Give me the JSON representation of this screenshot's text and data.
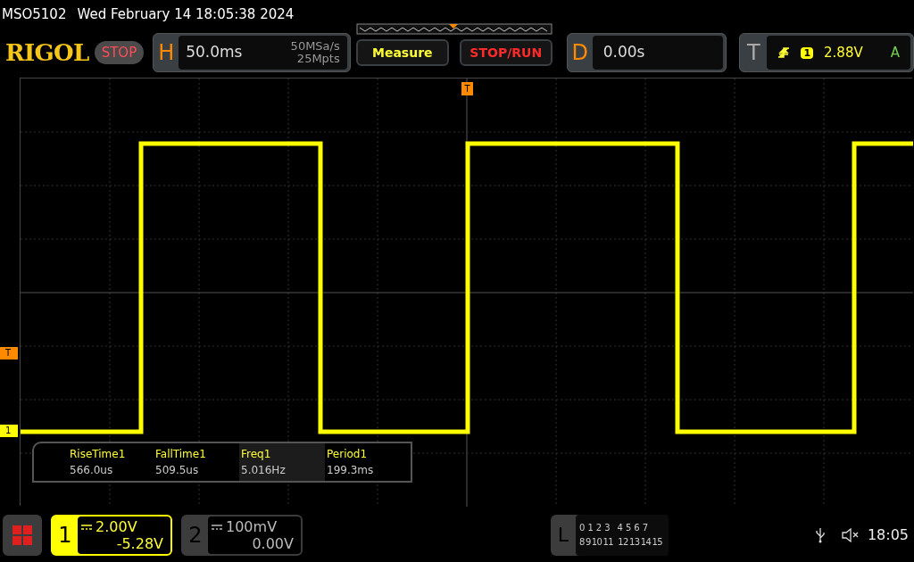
{
  "status_line": {
    "model": "MSO5102",
    "datetime": "Wed February 14 18:05:38 2024"
  },
  "header": {
    "logo": "RIGOL",
    "run_state": "STOP",
    "horizontal": {
      "label": "H",
      "timebase": "50.0ms",
      "sample_rate": "50MSa/s",
      "memory_depth": "25Mpts"
    },
    "buttons": [
      {
        "label": "Measure",
        "kind": "measure"
      },
      {
        "label": "STOP/RUN",
        "kind": "stoprun"
      }
    ],
    "delay": {
      "label": "D",
      "value": "0.00s"
    },
    "trigger": {
      "label": "T",
      "source": "1",
      "level": "2.88V",
      "mode": "A"
    }
  },
  "screen": {
    "top_marker": "T",
    "side_markers": [
      {
        "label": "T",
        "kind": "trigger"
      },
      {
        "label": "1",
        "kind": "channel"
      }
    ],
    "measurements": [
      {
        "name": "RiseTime1",
        "value": "566.0us",
        "selected": false
      },
      {
        "name": "FallTime1",
        "value": "509.5us",
        "selected": false
      },
      {
        "name": "Freq1",
        "value": "5.016Hz",
        "selected": true
      },
      {
        "name": "Period1",
        "value": "199.3ms",
        "selected": false
      }
    ]
  },
  "footer": {
    "channels": [
      {
        "number": "1",
        "scale": "2.00V",
        "offset": "-5.28V",
        "on": true
      },
      {
        "number": "2",
        "scale": "100mV",
        "offset": "0.00V",
        "on": false
      }
    ],
    "logic": {
      "label": "L",
      "row_1": [
        "0",
        "1",
        "2",
        "3",
        "4",
        "5",
        "6",
        "7"
      ],
      "row_2": [
        "8",
        "9",
        "10",
        "11",
        "12",
        "13",
        "14",
        "15"
      ]
    },
    "clock": "18:05"
  }
}
